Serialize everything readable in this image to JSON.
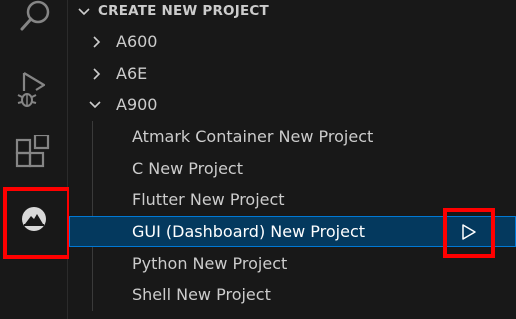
{
  "activity_bar": {
    "items": [
      {
        "name": "search",
        "icon": "search-icon"
      },
      {
        "name": "run-and-debug",
        "icon": "run-debug-icon"
      },
      {
        "name": "extensions",
        "icon": "extensions-icon"
      },
      {
        "name": "atmark-extension",
        "icon": "atmark-logo-icon",
        "active": true
      }
    ]
  },
  "explorer": {
    "section_title": "CREATE NEW PROJECT",
    "tree": [
      {
        "label": "A600",
        "expanded": false
      },
      {
        "label": "A6E",
        "expanded": false
      },
      {
        "label": "A900",
        "expanded": true,
        "children": [
          {
            "label": "Atmark Container New Project"
          },
          {
            "label": "C New Project"
          },
          {
            "label": "Flutter New Project"
          },
          {
            "label": "GUI (Dashboard) New Project",
            "selected": true,
            "action_icon": "play-icon"
          },
          {
            "label": "Python New Project"
          },
          {
            "label": "Shell New Project"
          }
        ]
      }
    ]
  },
  "colors": {
    "highlight": "#ff0000",
    "selection_bg": "#04395e",
    "selection_border": "#0078d4"
  }
}
